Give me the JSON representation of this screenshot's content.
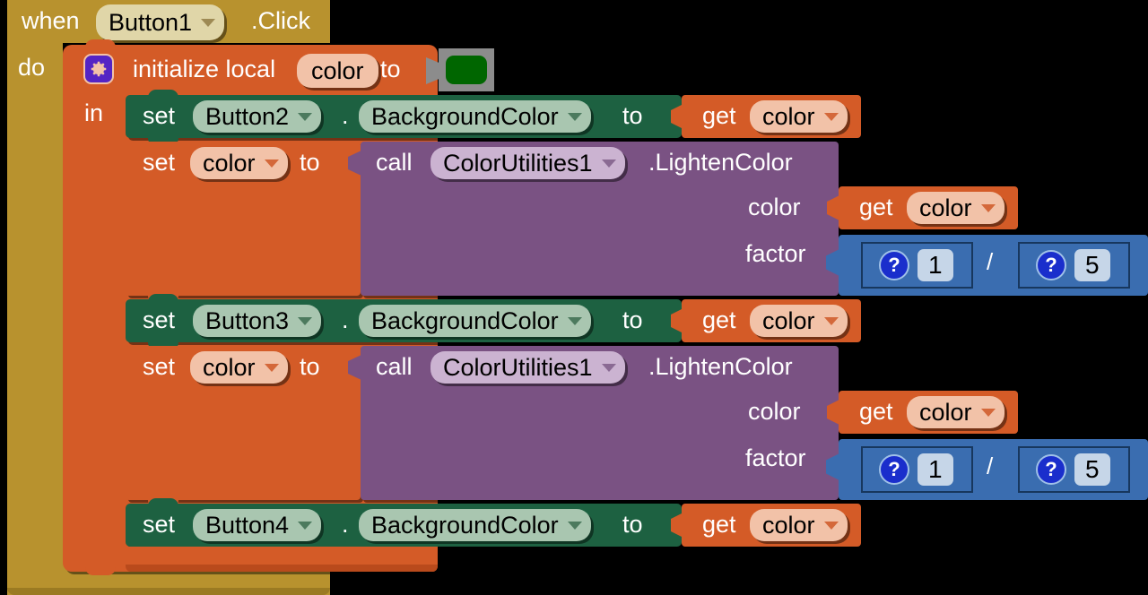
{
  "meta": {
    "app": "MIT App Inventor Blocks Editor",
    "canvas_background": "#000000"
  },
  "palette": {
    "event_gold": "#b8922e",
    "variable_orange": "#d45b27",
    "component_green": "#1d6141",
    "procedure_purple": "#7a5283",
    "math_blue": "#3a6db0",
    "color_block_gray": "#8c8c8c",
    "color_value": "#006600"
  },
  "event_block": {
    "name": "when-button1-click",
    "when_label": "when",
    "component": "Button1",
    "event": ".Click",
    "do_label": "do"
  },
  "init_local": {
    "name": "initialize-local-color",
    "gear_icon": "mutator-gear-icon",
    "init_label": "initialize local",
    "variable": "color",
    "to_label": "to",
    "in_label": "in",
    "color_value": "#006600"
  },
  "statements": [
    {
      "kind": "set_component_property",
      "set_label": "set",
      "component": "Button2",
      "dot": ".",
      "property": "BackgroundColor",
      "to_label": "to",
      "value": {
        "kind": "get_variable",
        "get_label": "get",
        "variable": "color"
      }
    },
    {
      "kind": "set_variable",
      "set_label": "set",
      "variable": "color",
      "to_label": "to",
      "value": {
        "kind": "call_method",
        "call_label": "call",
        "component": "ColorUtilities1",
        "method": ".LightenColor",
        "args": [
          {
            "label": "color",
            "value": {
              "kind": "get_variable",
              "get_label": "get",
              "variable": "color"
            }
          },
          {
            "label": "factor",
            "value": {
              "kind": "division",
              "operator": "/",
              "numerator": {
                "help_icon": "?",
                "number": "1"
              },
              "denominator": {
                "help_icon": "?",
                "number": "5"
              }
            }
          }
        ]
      }
    },
    {
      "kind": "set_component_property",
      "set_label": "set",
      "component": "Button3",
      "dot": ".",
      "property": "BackgroundColor",
      "to_label": "to",
      "value": {
        "kind": "get_variable",
        "get_label": "get",
        "variable": "color"
      }
    },
    {
      "kind": "set_variable",
      "set_label": "set",
      "variable": "color",
      "to_label": "to",
      "value": {
        "kind": "call_method",
        "call_label": "call",
        "component": "ColorUtilities1",
        "method": ".LightenColor",
        "args": [
          {
            "label": "color",
            "value": {
              "kind": "get_variable",
              "get_label": "get",
              "variable": "color"
            }
          },
          {
            "label": "factor",
            "value": {
              "kind": "division",
              "operator": "/",
              "numerator": {
                "help_icon": "?",
                "number": "1"
              },
              "denominator": {
                "help_icon": "?",
                "number": "5"
              }
            }
          }
        ]
      }
    },
    {
      "kind": "set_component_property",
      "set_label": "set",
      "component": "Button4",
      "dot": ".",
      "property": "BackgroundColor",
      "to_label": "to",
      "value": {
        "kind": "get_variable",
        "get_label": "get",
        "variable": "color"
      }
    }
  ]
}
